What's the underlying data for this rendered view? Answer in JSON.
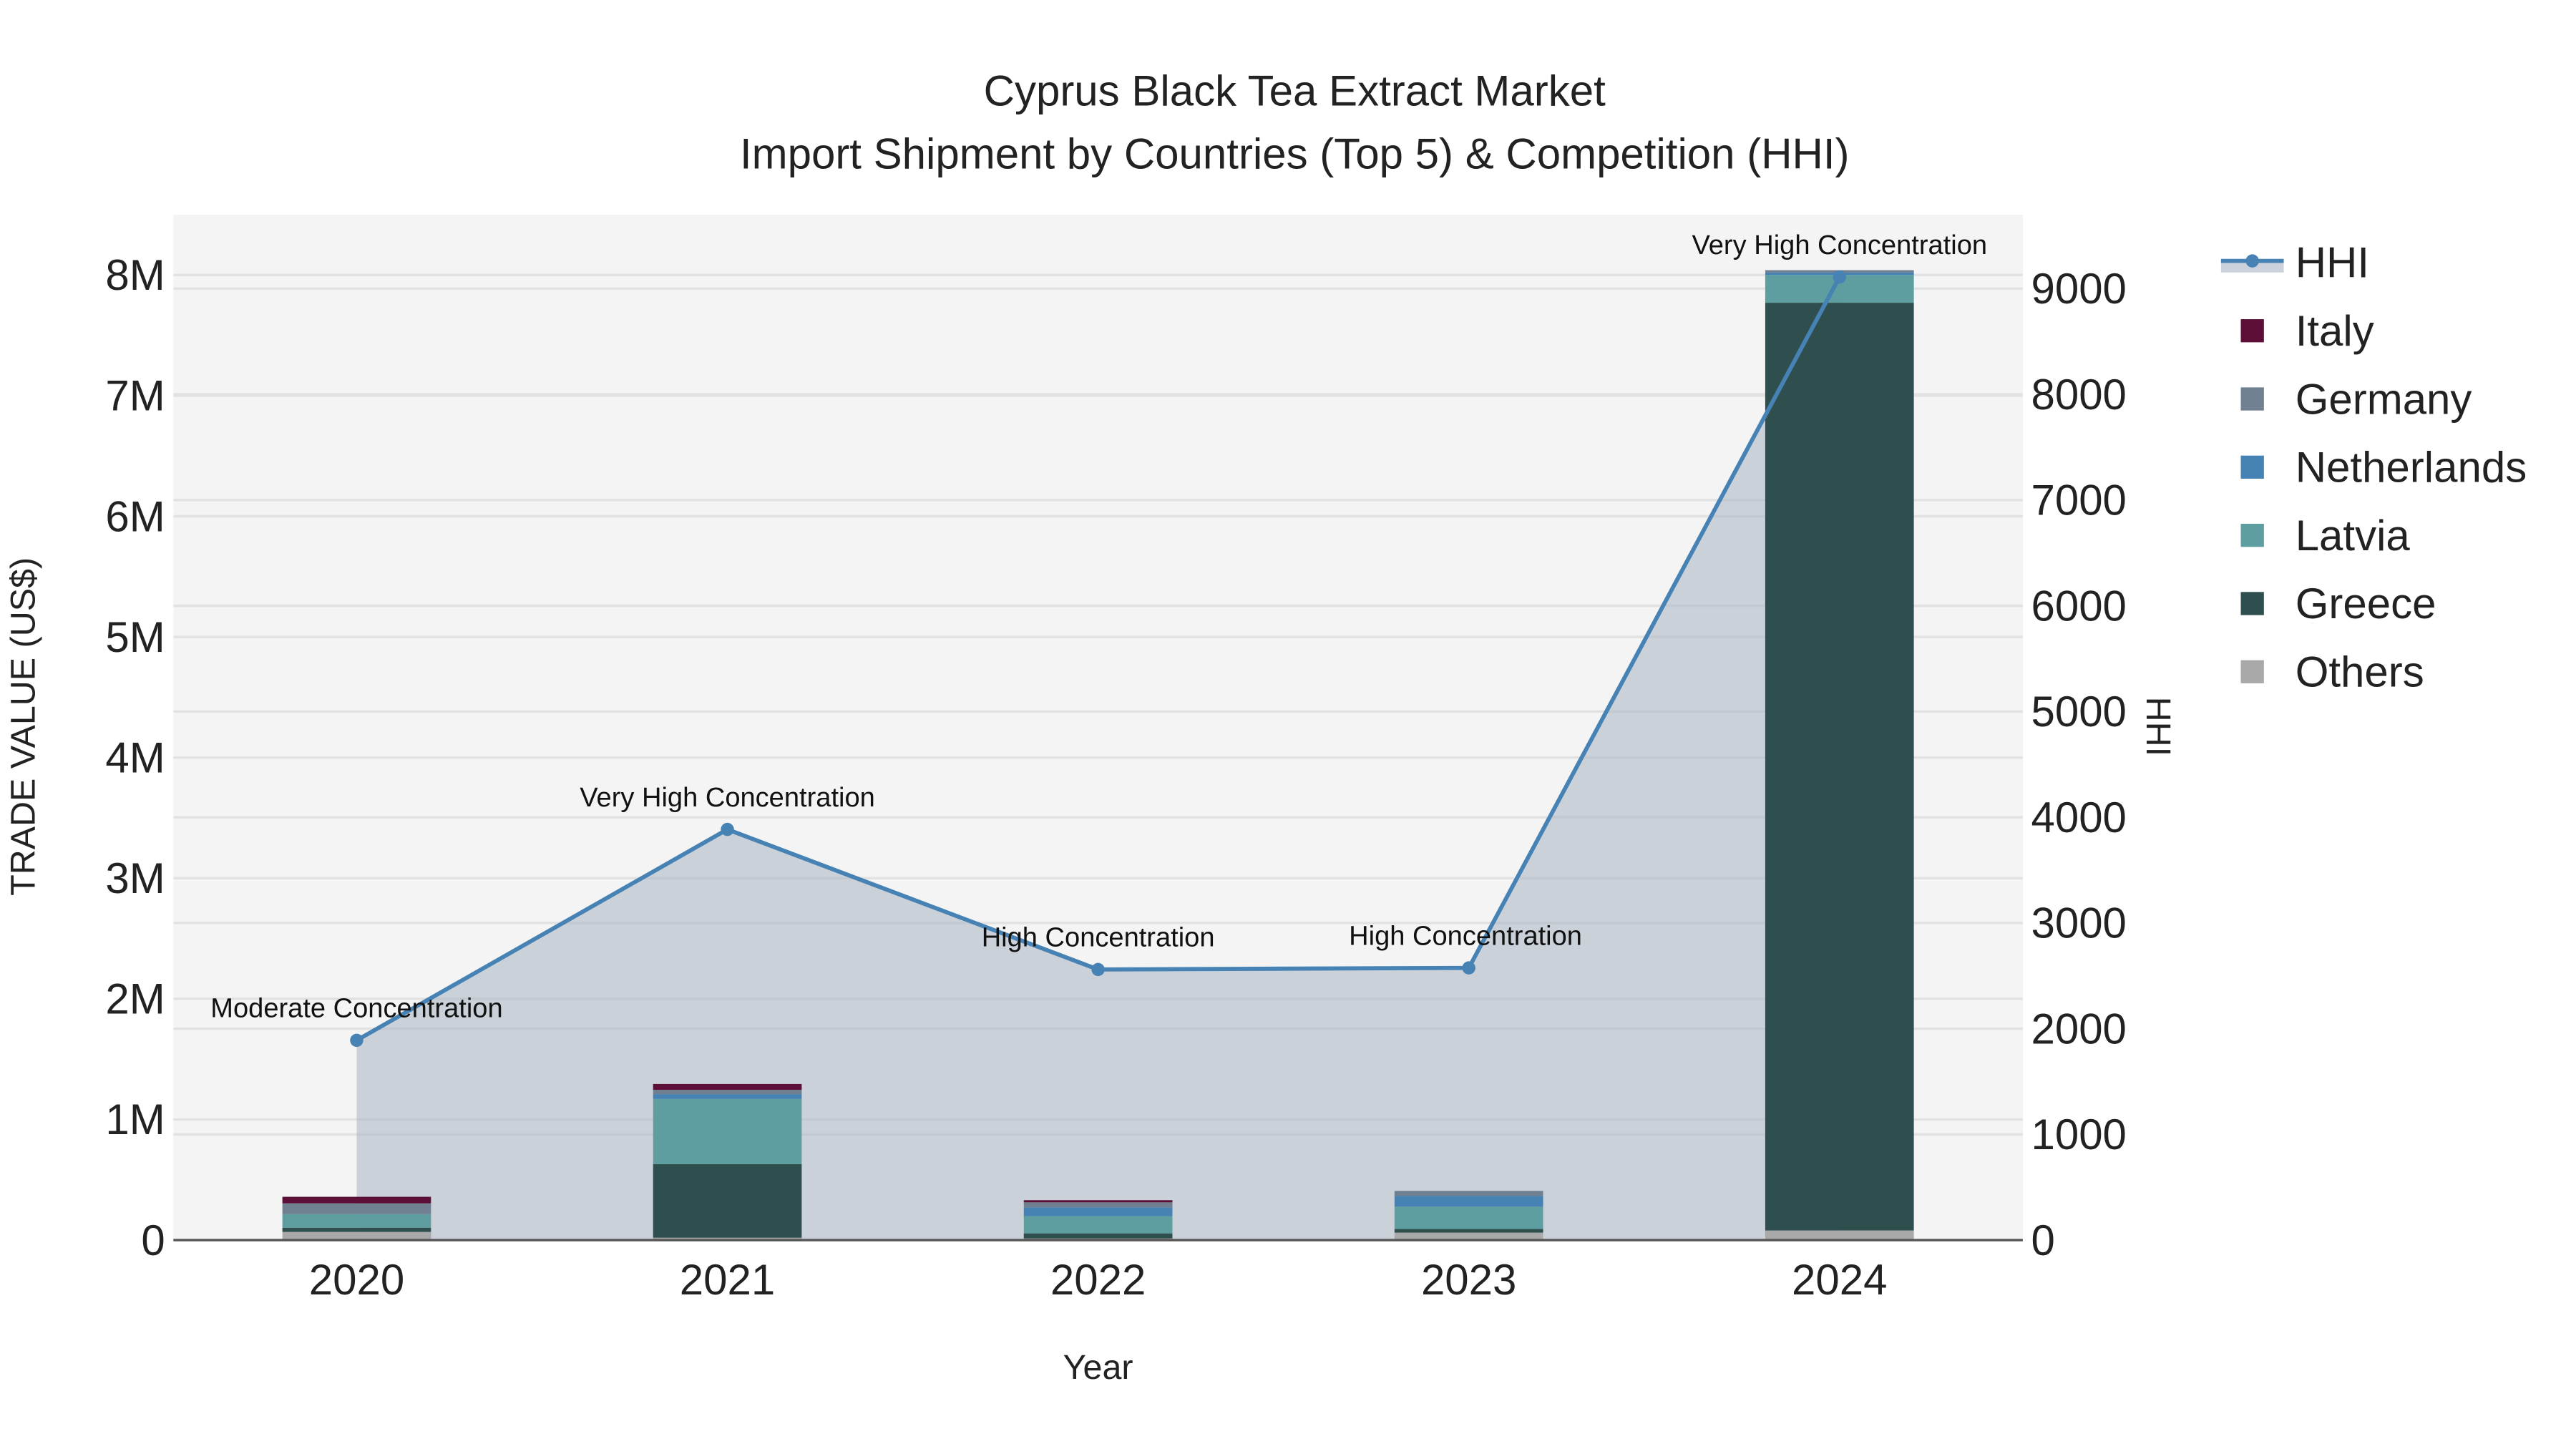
{
  "chart_data": {
    "type": "bar",
    "title_line1": "Cyprus Black Tea Extract Market",
    "title_line2": "Import Shipment by Countries (Top 5) & Competition (HHI)",
    "xlabel": "Year",
    "ylabel": "TRADE VALUE (US$)",
    "y2label": "HHI",
    "categories": [
      "2020",
      "2021",
      "2022",
      "2023",
      "2024"
    ],
    "ylim": [
      0,
      8500000
    ],
    "y2lim": [
      0,
      9700
    ],
    "yticks": [
      0,
      1000000,
      2000000,
      3000000,
      4000000,
      5000000,
      6000000,
      7000000,
      8000000
    ],
    "ytick_labels": [
      "0",
      "1M",
      "2M",
      "3M",
      "4M",
      "5M",
      "6M",
      "7M",
      "8M"
    ],
    "y2ticks": [
      0,
      1000,
      2000,
      3000,
      4000,
      5000,
      6000,
      7000,
      8000,
      9000
    ],
    "y2tick_labels": [
      "0",
      "1000",
      "2000",
      "3000",
      "4000",
      "5000",
      "6000",
      "7000",
      "8000",
      "9000"
    ],
    "series": [
      {
        "name": "Others",
        "color": "#a9a9a9",
        "values": [
          68000,
          20000,
          14000,
          62000,
          80000
        ]
      },
      {
        "name": "Greece",
        "color": "#2f4f4f",
        "values": [
          35000,
          610000,
          42000,
          30000,
          7690000
        ]
      },
      {
        "name": "Latvia",
        "color": "#5f9ea0",
        "values": [
          113000,
          540000,
          143000,
          185000,
          230000
        ]
      },
      {
        "name": "Netherlands",
        "color": "#4682b4",
        "values": [
          0,
          40000,
          72000,
          89000,
          20000
        ]
      },
      {
        "name": "Germany",
        "color": "#708090",
        "values": [
          89000,
          36000,
          42000,
          42000,
          20000
        ]
      },
      {
        "name": "Italy",
        "color": "#5e0f38",
        "values": [
          54000,
          48000,
          18000,
          0,
          0
        ]
      }
    ],
    "hhi": {
      "name": "HHI",
      "color": "#4682b4",
      "values": [
        1890,
        3885,
        2560,
        2575,
        9110
      ],
      "annotations": [
        "Moderate Concentration",
        "Very High Concentration",
        "High Concentration",
        "High Concentration",
        "Very High Concentration"
      ]
    },
    "legend_order": [
      "HHI",
      "Italy",
      "Germany",
      "Netherlands",
      "Latvia",
      "Greece",
      "Others"
    ],
    "legend_position": "right",
    "grid": true
  }
}
